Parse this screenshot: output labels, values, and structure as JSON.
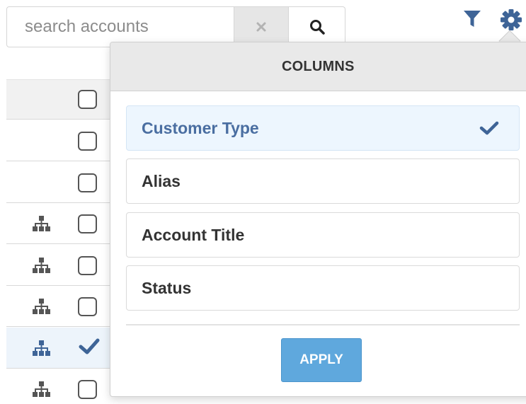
{
  "search": {
    "placeholder": "search accounts",
    "value": ""
  },
  "toolbar": {
    "clear_icon": "close-icon",
    "search_icon": "search-icon",
    "filter_icon": "filter-icon",
    "settings_icon": "gear-icon"
  },
  "table": {
    "rows": [
      {
        "hierarchy_icon": false,
        "checked": false
      },
      {
        "hierarchy_icon": false,
        "checked": false
      },
      {
        "hierarchy_icon": true,
        "checked": false
      },
      {
        "hierarchy_icon": true,
        "checked": false
      },
      {
        "hierarchy_icon": true,
        "checked": false
      },
      {
        "hierarchy_icon": true,
        "checked": true
      },
      {
        "hierarchy_icon": true,
        "checked": false
      }
    ]
  },
  "columns_popover": {
    "title": "COLUMNS",
    "items": [
      {
        "label": "Customer Type",
        "selected": true
      },
      {
        "label": "Alias",
        "selected": false
      },
      {
        "label": "Account Title",
        "selected": false
      },
      {
        "label": "Status",
        "selected": false
      }
    ],
    "apply_label": "APPLY"
  },
  "colors": {
    "accent": "#4a6ea1",
    "apply_button": "#5fa8dd",
    "selected_bg": "#edf6fe"
  }
}
